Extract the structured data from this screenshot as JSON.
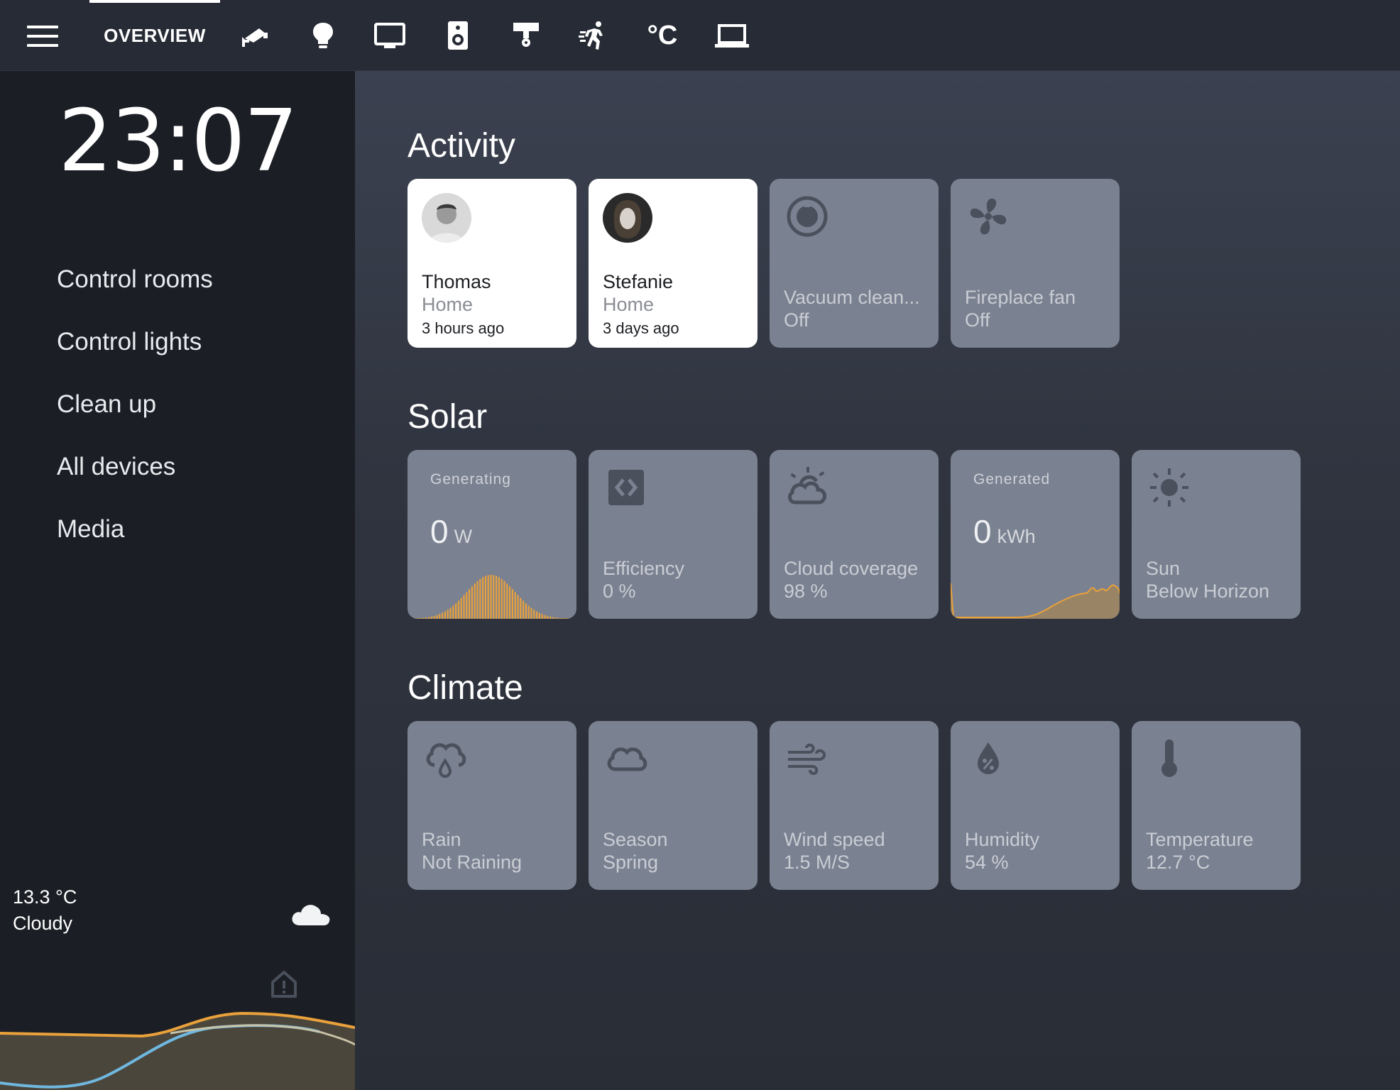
{
  "topbar": {
    "tabs": [
      {
        "label": "OVERVIEW",
        "icon": "overview"
      },
      {
        "label": "",
        "icon": "cctv-camera-icon"
      },
      {
        "label": "",
        "icon": "lightbulb-icon"
      },
      {
        "label": "",
        "icon": "monitor-icon"
      },
      {
        "label": "",
        "icon": "speaker-icon"
      },
      {
        "label": "",
        "icon": "ceiling-light-icon"
      },
      {
        "label": "",
        "icon": "motion-sensor-icon"
      },
      {
        "label": "",
        "icon": "celsius-icon"
      },
      {
        "label": "",
        "icon": "laptop-icon"
      }
    ],
    "celsius_glyph": "°C"
  },
  "sidebar": {
    "clock": "23:07",
    "nav": [
      {
        "label": "Control rooms"
      },
      {
        "label": "Control lights"
      },
      {
        "label": "Clean up"
      },
      {
        "label": "All devices"
      },
      {
        "label": "Media"
      }
    ],
    "weather": {
      "temperature": "13.3 °C",
      "condition": "Cloudy",
      "icon": "cloud-icon"
    }
  },
  "sections": {
    "activity": {
      "title": "Activity",
      "cards": [
        {
          "name": "Thomas",
          "state": "Home",
          "ago": "3 hours ago"
        },
        {
          "name": "Stefanie",
          "state": "Home",
          "ago": "3 days ago"
        },
        {
          "name": "Vacuum clean...",
          "state": "Off",
          "icon": "robot-vacuum-icon"
        },
        {
          "name": "Fireplace fan",
          "state": "Off",
          "icon": "fan-icon"
        }
      ]
    },
    "solar": {
      "title": "Solar",
      "cards": [
        {
          "label": "Generating",
          "value": "0",
          "unit": "W"
        },
        {
          "name": "Efficiency",
          "state": "0 %",
          "icon": "solar-panel-icon"
        },
        {
          "name": "Cloud coverage",
          "state": "98 %",
          "icon": "partly-cloudy-icon"
        },
        {
          "label": "Generated",
          "value": "0",
          "unit": "kWh"
        },
        {
          "name": "Sun",
          "state": "Below Horizon",
          "icon": "sun-icon"
        }
      ]
    },
    "climate": {
      "title": "Climate",
      "cards": [
        {
          "name": "Rain",
          "state": "Not Raining",
          "icon": "rain-icon"
        },
        {
          "name": "Season",
          "state": "Spring",
          "icon": "cloud-outline-icon"
        },
        {
          "name": "Wind speed",
          "state": "1.5 M/S",
          "icon": "wind-icon"
        },
        {
          "name": "Humidity",
          "state": "54 %",
          "icon": "humidity-icon"
        },
        {
          "name": "Temperature",
          "state": "12.7 °C",
          "icon": "thermometer-icon"
        }
      ]
    }
  },
  "colors": {
    "accent_orange": "#e9a13b",
    "card_bg": "#7a8190",
    "sidebar_bg": "#1b1e24",
    "topbar_bg": "#262b35"
  }
}
